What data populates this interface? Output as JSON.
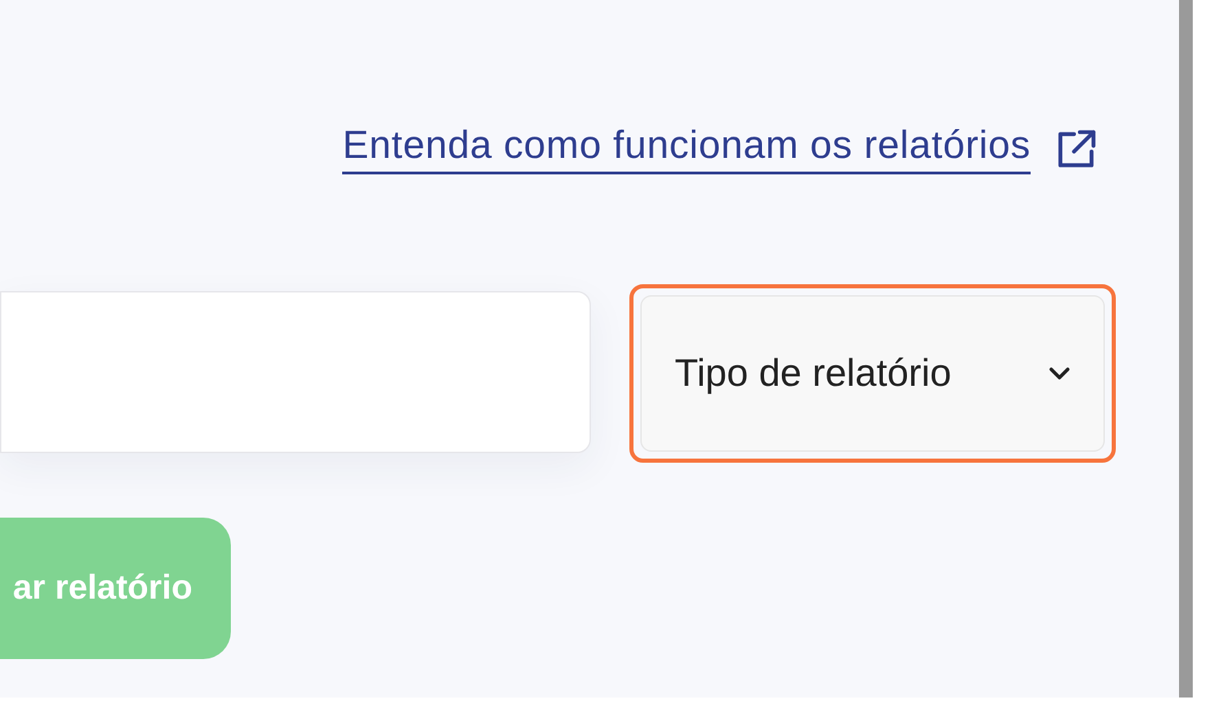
{
  "help_link": {
    "text": "Entenda como funcionam os relatórios"
  },
  "report_type_dropdown": {
    "label": "Tipo de relatório",
    "highlighted": true
  },
  "generate_button": {
    "label": "ar relatório"
  }
}
